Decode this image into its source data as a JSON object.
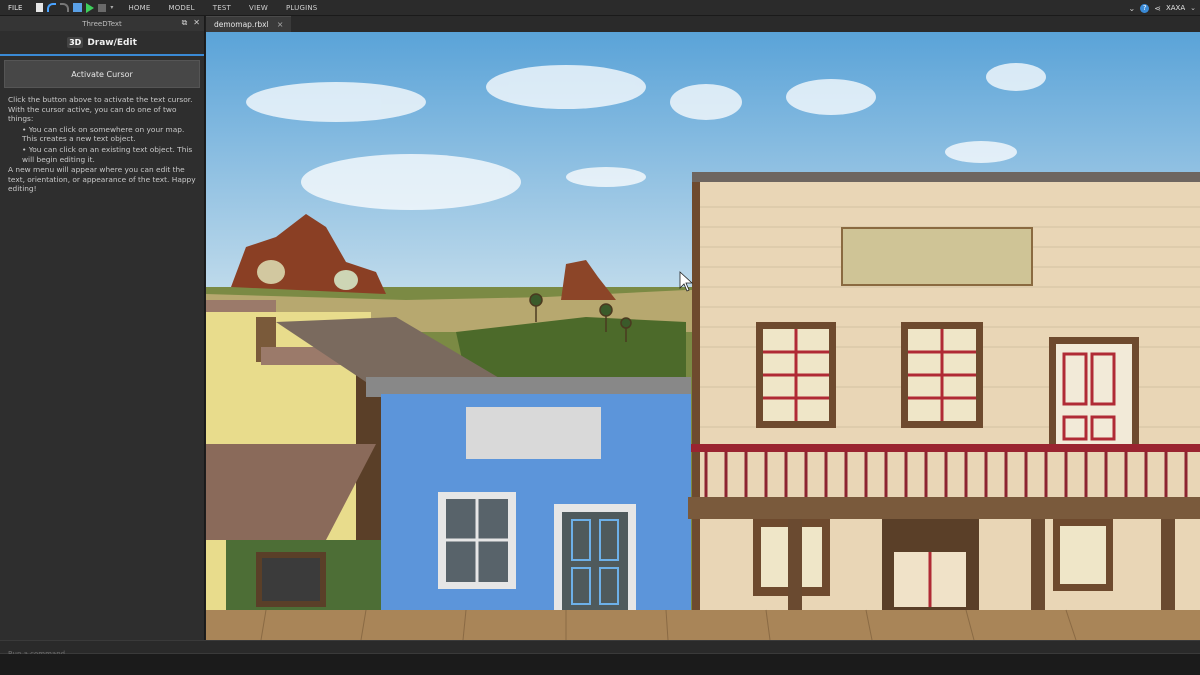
{
  "menubar": {
    "file": "FILE",
    "items": [
      "HOME",
      "MODEL",
      "TEST",
      "VIEW",
      "PLUGINS"
    ],
    "user": "XAXA"
  },
  "panel": {
    "window_title": "ThreeDText",
    "logo_text": "3D",
    "tab_label": "Draw/Edit",
    "activate_button": "Activate Cursor",
    "intro": "Click the button above to activate the text cursor. With the cursor active, you can do one of two things:",
    "bullets": [
      "• You can click on somewhere on your map. This creates a new text object.",
      "• You can click on an existing text object. This will begin editing it."
    ],
    "outro": "A new menu will appear where you can edit the text, orientation, or appearance of the text. Happy editing!"
  },
  "document": {
    "tab_name": "demomap.rbxl",
    "close_glyph": "×"
  },
  "command": {
    "placeholder": "Run a command"
  },
  "colors": {
    "accent": "#3a8ad6",
    "sky_top": "#5aa3d8",
    "sky_bottom": "#cfe3ee",
    "blue_building": "#5c95da",
    "saloon_wall": "#e9d6b6",
    "railing_red": "#9a2430"
  }
}
